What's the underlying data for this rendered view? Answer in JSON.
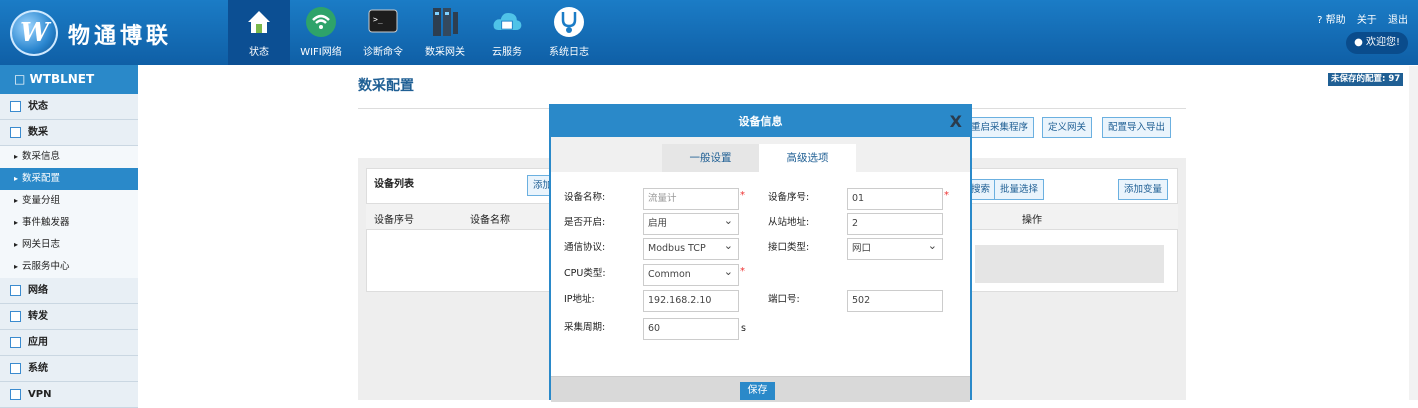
{
  "brand": {
    "logo_mark": "W",
    "name": "物通博联"
  },
  "nav": [
    {
      "label": "状态",
      "icon": "home-icon",
      "active": true
    },
    {
      "label": "WIFI网络",
      "icon": "wifi-icon"
    },
    {
      "label": "诊断命令",
      "icon": "terminal-icon"
    },
    {
      "label": "数采网关",
      "icon": "server-icon"
    },
    {
      "label": "云服务",
      "icon": "cloud-icon"
    },
    {
      "label": "系统日志",
      "icon": "stethoscope-icon"
    }
  ],
  "topright": {
    "help": "? 帮助",
    "about": "关于",
    "logout": "退出",
    "welcome": "欢迎您!"
  },
  "sidebar": {
    "device": "WTBLNET",
    "groups": [
      {
        "label": "状态"
      },
      {
        "label": "数采",
        "subs": [
          "数采信息",
          "数采配置",
          "变量分组",
          "事件触发器",
          "网关日志",
          "云服务中心"
        ]
      },
      {
        "label": "网络"
      },
      {
        "label": "转发"
      },
      {
        "label": "应用"
      },
      {
        "label": "系统"
      },
      {
        "label": "VPN"
      }
    ]
  },
  "main": {
    "title": "数采配置",
    "btn_restart": "重启采集程序",
    "btn_define": "定义网关",
    "btn_import": "配置导入导出",
    "card_title": "设备列表",
    "btn_add_dev": "添加",
    "btn_search": "搜索",
    "btn_batch": "批量选择",
    "btn_add_var": "添加变量",
    "col_serial": "设备序号",
    "col_name": "设备名称",
    "col_op": "操作",
    "unsaved": "未保存的配置: 97"
  },
  "modal": {
    "title": "设备信息",
    "close": "X",
    "tab_general": "一般设置",
    "tab_advanced": "高级选项",
    "lbl_name": "设备名称:",
    "ph_name": "流量计",
    "lbl_serial": "设备序号:",
    "val_serial": "01",
    "lbl_enable": "是否开启:",
    "val_enable": "启用",
    "lbl_slave": "从站地址:",
    "val_slave": "2",
    "lbl_protocol": "通信协议:",
    "val_protocol": "Modbus TCP",
    "lbl_iface": "接口类型:",
    "val_iface": "网口",
    "lbl_cpu": "CPU类型:",
    "val_cpu": "Common",
    "lbl_ip": "IP地址:",
    "val_ip": "192.168.2.10",
    "lbl_port": "端口号:",
    "val_port": "502",
    "lbl_period": "采集周期:",
    "val_period": "60",
    "unit_s": "s",
    "save": "保存"
  }
}
